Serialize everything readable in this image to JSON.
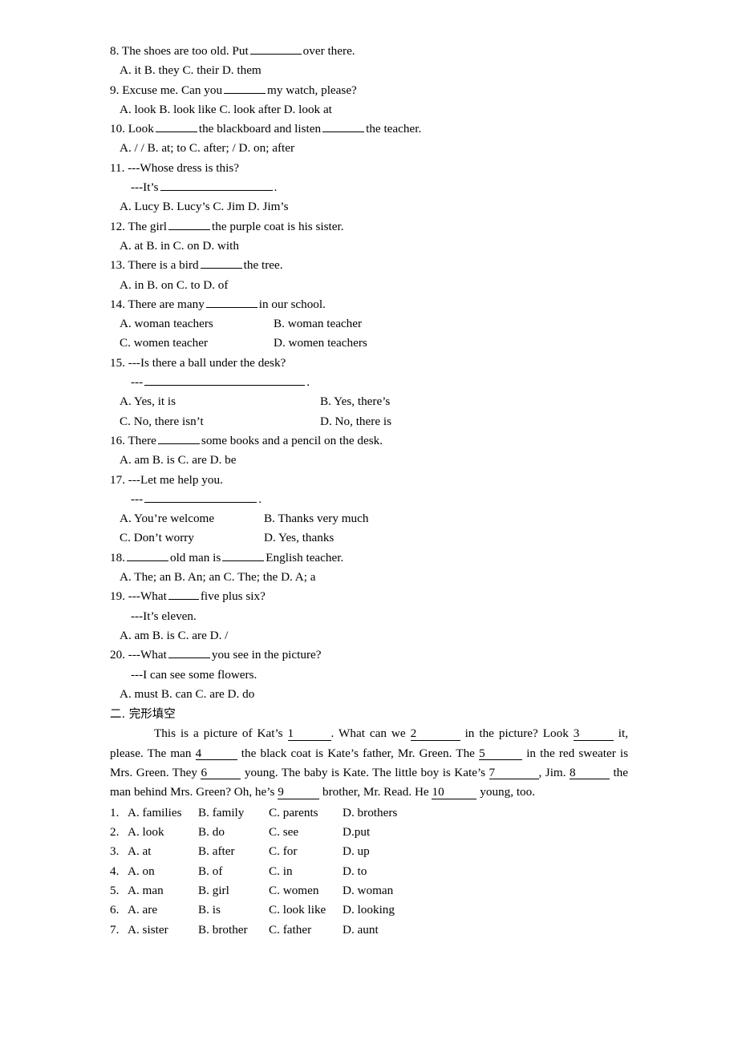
{
  "document": {
    "title": "English exam worksheet page",
    "multiple_choice": [
      {
        "number": "8.",
        "stem_before": "8. The shoes are too old. Put",
        "stem_after": "over there.",
        "options_line": "A. it   B. they   C. their   D. them"
      },
      {
        "number": "9.",
        "stem_before": "9. Excuse me. Can you",
        "stem_after": "my watch, please?",
        "options_line": "A. look   B. look like   C. look after   D. look at"
      },
      {
        "number": "10.",
        "stem_before": "10. Look",
        "stem_middle": "the blackboard and listen",
        "stem_after": "the teacher.",
        "options_line": "A. / /     B. at; to   C. after; /   D. on; after"
      },
      {
        "number": "11.",
        "stem": "11. ---Whose dress is this?",
        "sub_before": "---It’s",
        "sub_after": ".",
        "options_line": "A. Lucy   B. Lucy’s   C. Jim   D. Jim’s"
      },
      {
        "number": "12.",
        "stem_before": "12. The girl",
        "stem_after": "the purple coat is his sister.",
        "options_line": "A. at   B. in   C. on   D. with"
      },
      {
        "number": "13.",
        "stem_before": "13. There is a bird",
        "stem_after": "the tree.",
        "options_line": "A. in   B. on   C. to   D. of"
      },
      {
        "number": "14.",
        "stem_before": "14. There are many",
        "stem_after": "in our school.",
        "option_a": "A. woman teachers",
        "option_b": "B. woman teacher",
        "option_c": "C. women teacher",
        "option_d": "D. women teachers"
      },
      {
        "number": "15.",
        "stem": "15. ---Is there a ball under the desk?",
        "sub_before": "---",
        "sub_after": ".",
        "option_a": "A. Yes, it is",
        "option_b": "B. Yes, there’s",
        "option_c": "C. No, there isn’t",
        "option_d": "D. No, there is"
      },
      {
        "number": "16.",
        "stem_before": "16. There",
        "stem_after": "some books and a pencil on the desk.",
        "options_line": "A. am   B. is   C. are   D. be"
      },
      {
        "number": "17.",
        "stem": "17. ---Let me help you.",
        "sub_before": "---",
        "sub_after": ".",
        "option_a": "A. You’re welcome",
        "option_b": "B. Thanks very much",
        "option_c": "C. Don’t worry",
        "option_d": "D. Yes, thanks"
      },
      {
        "number": "18.",
        "stem_before": "18.",
        "stem_middle": "old man is",
        "stem_after": "English teacher.",
        "options_line": "A. The; an   B. An; an   C. The; the   D. A; a"
      },
      {
        "number": "19.",
        "stem_before": "19. ---What",
        "stem_after": "five plus six?",
        "sub": "---It’s eleven.",
        "options_line": "A. am   B. is   C. are   D. /"
      },
      {
        "number": "20.",
        "stem_before": "20. ---What",
        "stem_after": "you see in the picture?",
        "sub": "---I can see some flowers.",
        "options_line": "A. must   B. can   C. are   D. do"
      }
    ],
    "section_two": {
      "heading": "二. 完形填空",
      "passage": {
        "t1": "This is a picture of Kat’s",
        "n1": "1",
        "t2": ". What can we",
        "n2": "2",
        "t3": "in the picture? Look",
        "n3": "3",
        "t4": "it, please. The man",
        "n4": "4",
        "t5": "the black coat is Kate’s father, Mr. Green. The",
        "n5": "5",
        "t6": "in the red sweater is Mrs. Green. They",
        "n6": "6",
        "t7": "young. The baby is Kate. The little boy is Kate’s",
        "n7": "7",
        "t8": ", Jim.",
        "n8": "8",
        "t9": "the man behind Mrs. Green? Oh, he’s",
        "n9": "9",
        "t10": "brother, Mr. Read. He",
        "n10": "10",
        "t11": "young, too."
      },
      "options": [
        {
          "n": "1.",
          "a": "A. families",
          "b": "B. family",
          "c": "C. parents",
          "d": "D. brothers"
        },
        {
          "n": "2.",
          "a": "A. look",
          "b": "B. do",
          "c": "C. see",
          "d": "D.put"
        },
        {
          "n": "3.",
          "a": "A. at",
          "b": "B. after",
          "c": "C. for",
          "d": "D. up"
        },
        {
          "n": "4.",
          "a": "A. on",
          "b": "B. of",
          "c": "C. in",
          "d": "D. to"
        },
        {
          "n": "5.",
          "a": "A. man",
          "b": "B. girl",
          "c": "C. women",
          "d": "D. woman"
        },
        {
          "n": "6.",
          "a": "A. are",
          "b": "B. is",
          "c": "C. look like",
          "d": "D. looking"
        },
        {
          "n": "7.",
          "a": "A. sister",
          "b": "B. brother",
          "c": "C. father",
          "d": "D. aunt"
        }
      ]
    }
  }
}
